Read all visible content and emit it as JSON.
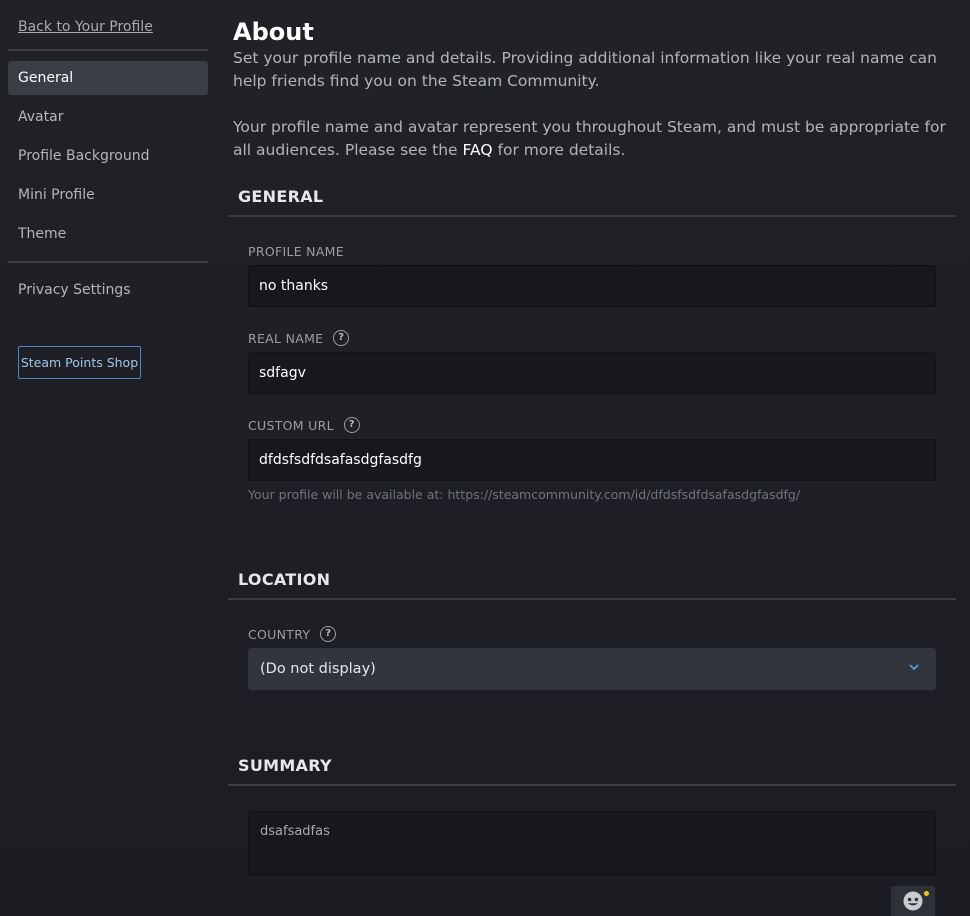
{
  "sidebar": {
    "back_link": "Back to Your Profile",
    "items": [
      {
        "label": "General",
        "active": true
      },
      {
        "label": "Avatar"
      },
      {
        "label": "Profile Background"
      },
      {
        "label": "Mini Profile"
      },
      {
        "label": "Theme"
      }
    ],
    "privacy": "Privacy Settings",
    "points_shop": "Steam Points Shop"
  },
  "page": {
    "title": "About",
    "intro_1": "Set your profile name and details. Providing additional information like your real name can help friends find you on the Steam Community.",
    "intro_2_before": "Your profile name and avatar represent you throughout Steam, and must be appropriate for all audiences. Please see the",
    "intro_2_link": "FAQ",
    "intro_2_after": "for more details."
  },
  "general": {
    "title": "GENERAL",
    "profile_name_label": "PROFILE NAME",
    "profile_name_value": "no thanks",
    "real_name_label": "REAL NAME",
    "real_name_value": "sdfagv",
    "custom_url_label": "CUSTOM URL",
    "custom_url_value": "dfdsfsdfdsafasdgfasdfg",
    "custom_url_hint": "Your profile will be available at: https://steamcommunity.com/id/dfdsfsdfdsafasdgfasdfg/"
  },
  "location": {
    "title": "LOCATION",
    "country_label": "COUNTRY",
    "country_value": "(Do not display)"
  },
  "summary": {
    "title": "SUMMARY",
    "value": "dsafsadfas"
  },
  "icons": {
    "help": "?",
    "dropdown": "chevron-down-icon",
    "emoticon": "emoticon-icon"
  },
  "colors": {
    "accent_blue": "#4b86c7",
    "notification_dot": "#f2c41a"
  }
}
